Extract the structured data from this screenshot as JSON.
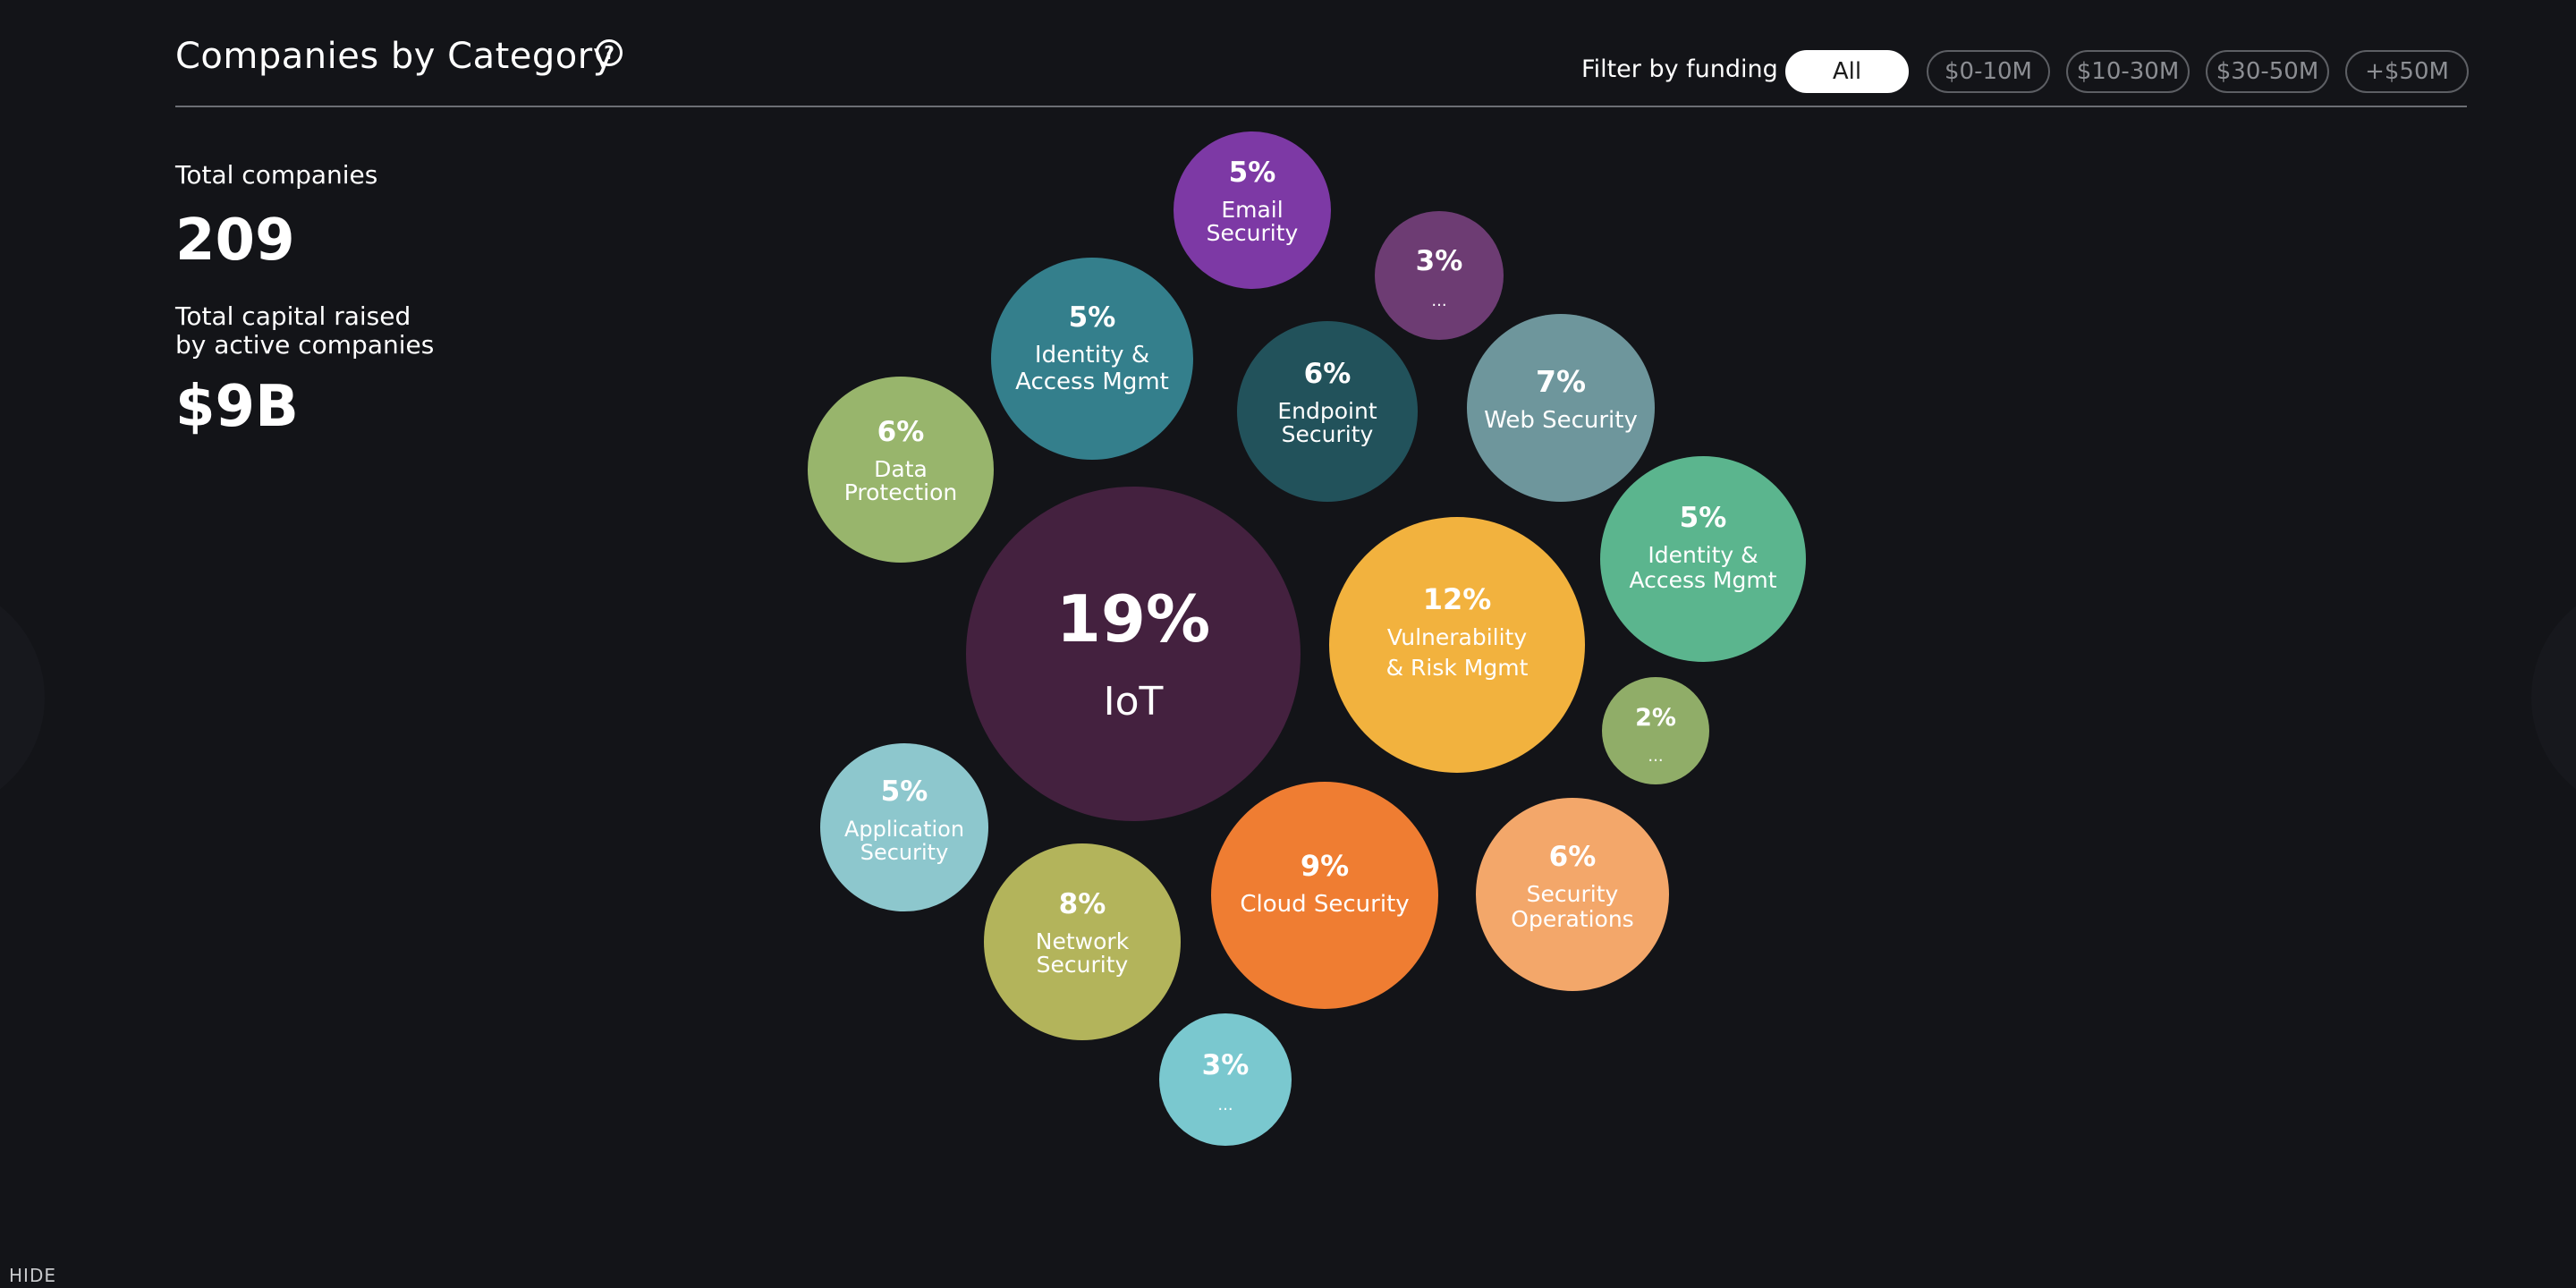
{
  "header": {
    "title": "Companies by Category",
    "help_icon": "question-circle-icon",
    "filter_label": "Filter by funding",
    "filters": [
      {
        "label": "All",
        "active": true
      },
      {
        "label": "$0-10M",
        "active": false
      },
      {
        "label": "$10-30M",
        "active": false
      },
      {
        "label": "$30-50M",
        "active": false
      },
      {
        "label": "+$50M",
        "active": false
      }
    ]
  },
  "stats": {
    "total_companies_label": "Total companies",
    "total_companies_value": "209",
    "capital_label_line1": "Total capital raised",
    "capital_label_line2": "by active companies",
    "capital_value": "$9B"
  },
  "footer": {
    "hide_label": "HIDE"
  },
  "colors": {
    "background": "#131418",
    "active_filter": "#ffffff"
  },
  "chart_data": {
    "type": "bubble",
    "bubbles": [
      {
        "pct": "19%",
        "lines": [
          "IoT"
        ],
        "value": 19,
        "color": "#44213f"
      },
      {
        "pct": "12%",
        "lines": [
          "Vulnerability",
          "& Risk Mgmt"
        ],
        "value": 12,
        "color": "#f2b23e"
      },
      {
        "pct": "9%",
        "lines": [
          "Cloud Security"
        ],
        "value": 9,
        "color": "#ef7d32"
      },
      {
        "pct": "8%",
        "lines": [
          "Network",
          "Security"
        ],
        "value": 8,
        "color": "#b3b45b"
      },
      {
        "pct": "7%",
        "lines": [
          "Web Security"
        ],
        "value": 7,
        "color": "#6e969c"
      },
      {
        "pct": "6%",
        "lines": [
          "Data",
          "Protection"
        ],
        "value": 6,
        "color": "#98b56c"
      },
      {
        "pct": "6%",
        "lines": [
          "Endpoint",
          "Security"
        ],
        "value": 6,
        "color": "#22525b"
      },
      {
        "pct": "6%",
        "lines": [
          "Security",
          "Operations"
        ],
        "value": 6,
        "color": "#f3a76a"
      },
      {
        "pct": "5%",
        "lines": [
          "Email",
          "Security"
        ],
        "value": 5,
        "color": "#7d39a5"
      },
      {
        "pct": "5%",
        "lines": [
          "Identity &",
          "Access Mgmt"
        ],
        "value": 5,
        "color": "#347f8c"
      },
      {
        "pct": "5%",
        "lines": [
          "Identity &",
          "Access Mgmt"
        ],
        "value": 5,
        "color": "#5bb58e"
      },
      {
        "pct": "5%",
        "lines": [
          "Application",
          "Security"
        ],
        "value": 5,
        "color": "#8dc7cd"
      },
      {
        "pct": "3%",
        "lines": [
          "..."
        ],
        "value": 3,
        "color": "#6d3c73"
      },
      {
        "pct": "3%",
        "lines": [
          "..."
        ],
        "value": 3,
        "color": "#7ac8cf"
      },
      {
        "pct": "2%",
        "lines": [
          "..."
        ],
        "value": 2,
        "color": "#90ad68"
      }
    ]
  }
}
